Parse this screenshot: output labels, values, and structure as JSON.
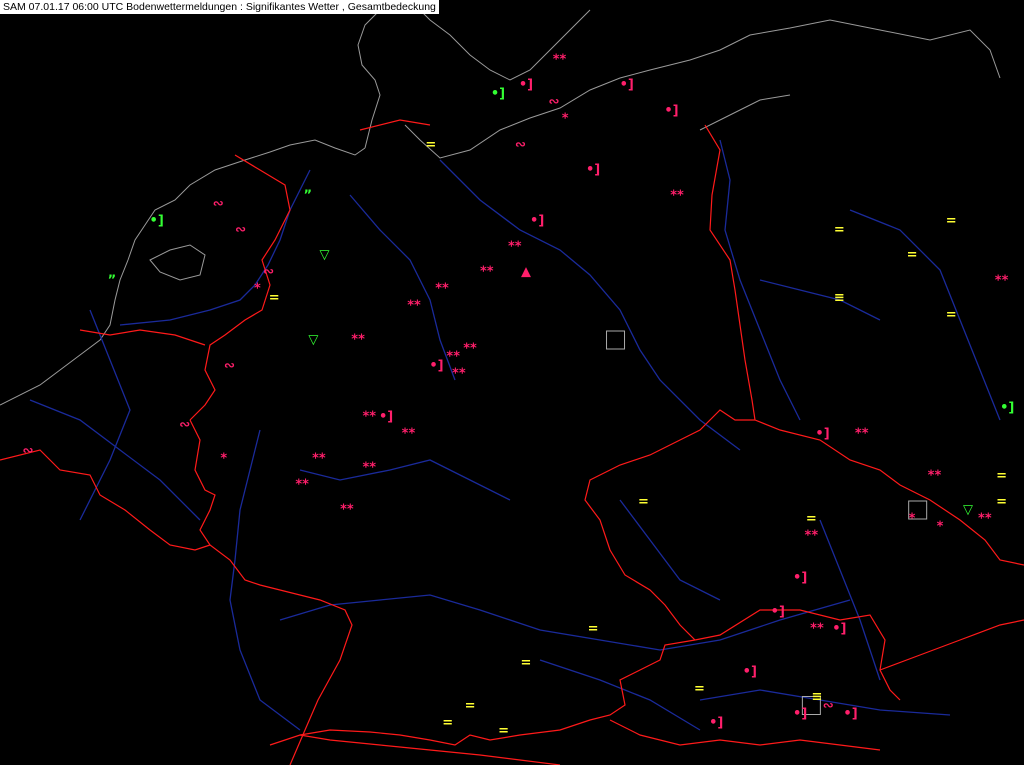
{
  "header": {
    "title": "SAM 07.01.17 06:00 UTC  Bodenwettermeldungen :  Signifikantes Wetter , Gesamtbedeckung"
  },
  "colors": {
    "background": "#000000",
    "border": "#ff1a1a",
    "river": "#1a2a9a",
    "coast": "#9a9a9a",
    "snow": "#ff1f6b",
    "fog": "#ffff33",
    "drizzle": "#33ff33",
    "marker_box": "#aaaaaa"
  },
  "legend_symbols": {
    "snow": "**",
    "light_snow": "*",
    "fog": "=",
    "drizzle": "•]",
    "shower": "▽",
    "freezing": "∾",
    "squall": "≡"
  },
  "observations": [
    {
      "sym": "**",
      "type": "snow",
      "lon": 10.0,
      "lat": 54.9
    },
    {
      "sym": "•]",
      "type": "snow",
      "lon": 9.4,
      "lat": 54.6
    },
    {
      "sym": "∾",
      "type": "snow",
      "lon": 9.9,
      "lat": 54.4
    },
    {
      "sym": "*",
      "type": "snow",
      "lon": 10.1,
      "lat": 54.2
    },
    {
      "sym": "∾",
      "type": "snow",
      "lon": 9.3,
      "lat": 53.9
    },
    {
      "sym": "•]",
      "type": "snow",
      "lon": 9.6,
      "lat": 53.0
    },
    {
      "sym": "**",
      "type": "snow",
      "lon": 9.2,
      "lat": 52.7
    },
    {
      "sym": "**",
      "type": "snow",
      "lon": 8.7,
      "lat": 52.4
    },
    {
      "sym": "▲",
      "type": "snow",
      "lon": 9.4,
      "lat": 52.4
    },
    {
      "sym": "**",
      "type": "snow",
      "lon": 7.9,
      "lat": 52.2
    },
    {
      "sym": "**",
      "type": "snow",
      "lon": 7.4,
      "lat": 52.0
    },
    {
      "sym": "**",
      "type": "snow",
      "lon": 8.1,
      "lat": 51.4
    },
    {
      "sym": "**",
      "type": "snow",
      "lon": 8.4,
      "lat": 51.5
    },
    {
      "sym": "**",
      "type": "snow",
      "lon": 8.2,
      "lat": 51.2
    },
    {
      "sym": "•]",
      "type": "snow",
      "lon": 7.8,
      "lat": 51.3
    },
    {
      "sym": "**",
      "type": "snow",
      "lon": 6.4,
      "lat": 51.6
    },
    {
      "sym": "**",
      "type": "snow",
      "lon": 6.6,
      "lat": 50.7
    },
    {
      "sym": "•]",
      "type": "snow",
      "lon": 6.9,
      "lat": 50.7
    },
    {
      "sym": "**",
      "type": "snow",
      "lon": 7.3,
      "lat": 50.5
    },
    {
      "sym": "**",
      "type": "snow",
      "lon": 5.7,
      "lat": 50.2
    },
    {
      "sym": "**",
      "type": "snow",
      "lon": 6.6,
      "lat": 50.1
    },
    {
      "sym": "**",
      "type": "snow",
      "lon": 5.4,
      "lat": 49.9
    },
    {
      "sym": "**",
      "type": "snow",
      "lon": 6.2,
      "lat": 49.6
    },
    {
      "sym": "•]",
      "type": "snow",
      "lon": 10.6,
      "lat": 53.6
    },
    {
      "sym": "•]",
      "type": "snow",
      "lon": 12.0,
      "lat": 54.3
    },
    {
      "sym": "•]",
      "type": "snow",
      "lon": 11.2,
      "lat": 54.6
    },
    {
      "sym": "**",
      "type": "snow",
      "lon": 12.1,
      "lat": 53.3
    },
    {
      "sym": "•]",
      "type": "snow",
      "lon": 14.7,
      "lat": 50.5
    },
    {
      "sym": "**",
      "type": "snow",
      "lon": 15.4,
      "lat": 50.5
    },
    {
      "sym": "**",
      "type": "snow",
      "lon": 16.7,
      "lat": 50.0
    },
    {
      "sym": "**",
      "type": "snow",
      "lon": 14.5,
      "lat": 49.3
    },
    {
      "sym": "•]",
      "type": "snow",
      "lon": 14.3,
      "lat": 48.8
    },
    {
      "sym": "•]",
      "type": "snow",
      "lon": 13.9,
      "lat": 48.4
    },
    {
      "sym": "**",
      "type": "snow",
      "lon": 14.6,
      "lat": 48.2
    },
    {
      "sym": "•]",
      "type": "snow",
      "lon": 15.0,
      "lat": 48.2
    },
    {
      "sym": "•]",
      "type": "snow",
      "lon": 13.4,
      "lat": 47.7
    },
    {
      "sym": "•]",
      "type": "snow",
      "lon": 15.2,
      "lat": 47.2
    },
    {
      "sym": "∾",
      "type": "snow",
      "lon": 14.8,
      "lat": 47.3
    },
    {
      "sym": "•]",
      "type": "snow",
      "lon": 14.3,
      "lat": 47.2
    },
    {
      "sym": "•]",
      "type": "snow",
      "lon": 12.8,
      "lat": 47.1
    },
    {
      "sym": "∾",
      "type": "snow",
      "lon": 3.9,
      "lat": 53.2
    },
    {
      "sym": "∾",
      "type": "snow",
      "lon": 4.3,
      "lat": 52.9
    },
    {
      "sym": "∾",
      "type": "snow",
      "lon": 4.8,
      "lat": 52.4
    },
    {
      "sym": "*",
      "type": "snow",
      "lon": 4.6,
      "lat": 52.2
    },
    {
      "sym": "∾",
      "type": "snow",
      "lon": 4.1,
      "lat": 51.3
    },
    {
      "sym": "∾",
      "type": "snow",
      "lon": 3.3,
      "lat": 50.6
    },
    {
      "sym": "*",
      "type": "snow",
      "lon": 4.0,
      "lat": 50.2
    },
    {
      "sym": "∾",
      "type": "snow",
      "lon": 0.5,
      "lat": 50.3
    },
    {
      "sym": "*",
      "type": "snow",
      "lon": 16.3,
      "lat": 49.5
    },
    {
      "sym": "*",
      "type": "snow",
      "lon": 16.8,
      "lat": 49.4
    },
    {
      "sym": "**",
      "type": "snow",
      "lon": 17.6,
      "lat": 49.5
    },
    {
      "sym": "**",
      "type": "snow",
      "lon": 17.9,
      "lat": 52.3
    },
    {
      "sym": "=",
      "type": "fog",
      "lon": 17.0,
      "lat": 53.0
    },
    {
      "sym": "=",
      "type": "fog",
      "lon": 15.0,
      "lat": 52.9
    },
    {
      "sym": "=",
      "type": "fog",
      "lon": 16.3,
      "lat": 52.6
    },
    {
      "sym": "=",
      "type": "fog",
      "lon": 17.0,
      "lat": 51.9
    },
    {
      "sym": "≡",
      "type": "fog",
      "lon": 15.0,
      "lat": 52.1
    },
    {
      "sym": "=",
      "type": "fog",
      "lon": 17.9,
      "lat": 50.0
    },
    {
      "sym": "=",
      "type": "fog",
      "lon": 17.9,
      "lat": 49.7
    },
    {
      "sym": "=",
      "type": "fog",
      "lon": 14.5,
      "lat": 49.5
    },
    {
      "sym": "=",
      "type": "fog",
      "lon": 11.5,
      "lat": 49.7
    },
    {
      "sym": "=",
      "type": "fog",
      "lon": 10.6,
      "lat": 48.2
    },
    {
      "sym": "=",
      "type": "fog",
      "lon": 9.4,
      "lat": 47.8
    },
    {
      "sym": "=",
      "type": "fog",
      "lon": 12.5,
      "lat": 47.5
    },
    {
      "sym": "=",
      "type": "fog",
      "lon": 8.4,
      "lat": 47.3
    },
    {
      "sym": "=",
      "type": "fog",
      "lon": 8.0,
      "lat": 47.1
    },
    {
      "sym": "=",
      "type": "fog",
      "lon": 9.0,
      "lat": 47.0
    },
    {
      "sym": "≡",
      "type": "fog",
      "lon": 14.6,
      "lat": 47.4
    },
    {
      "sym": "=",
      "type": "fog",
      "lon": 4.9,
      "lat": 52.1
    },
    {
      "sym": "=",
      "type": "fog",
      "lon": 7.7,
      "lat": 53.9
    },
    {
      "sym": "≡",
      "type": "fog",
      "lon": -0.2,
      "lat": 53.4
    },
    {
      "sym": "•]",
      "type": "drizzle",
      "lon": 2.8,
      "lat": 53.0
    },
    {
      "sym": "•]",
      "type": "drizzle",
      "lon": 8.9,
      "lat": 54.5
    },
    {
      "sym": "”",
      "type": "drizzle",
      "lon": 2.0,
      "lat": 52.3
    },
    {
      "sym": "”",
      "type": "drizzle",
      "lon": 5.5,
      "lat": 53.3
    },
    {
      "sym": "▽",
      "type": "drizzle",
      "lon": 5.8,
      "lat": 52.6
    },
    {
      "sym": "▽",
      "type": "drizzle",
      "lon": 5.6,
      "lat": 51.6
    },
    {
      "sym": "▽",
      "type": "drizzle",
      "lon": 17.3,
      "lat": 49.6
    },
    {
      "sym": "•]",
      "type": "drizzle",
      "lon": 18.0,
      "lat": 50.8
    }
  ],
  "station_boxes": [
    {
      "lon": 11.0,
      "lat": 51.6
    },
    {
      "lon": 16.4,
      "lat": 49.6
    },
    {
      "lon": 14.5,
      "lat": 47.3
    }
  ]
}
